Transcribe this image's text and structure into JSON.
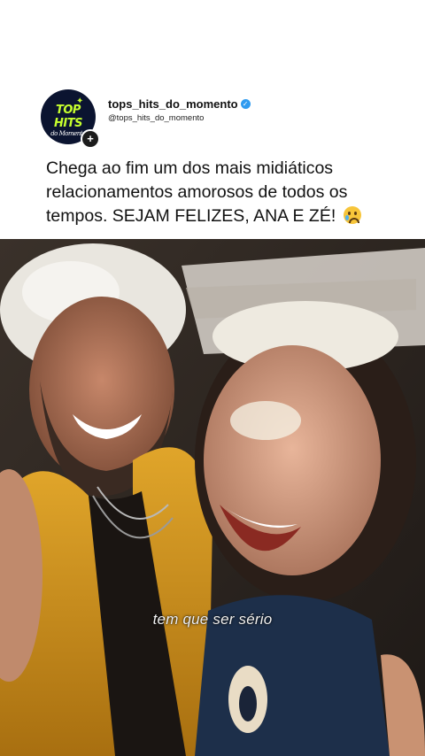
{
  "post": {
    "avatar": {
      "logo_top": "TOP",
      "logo_mid": "HITS",
      "logo_bottom": "do Momento",
      "icon": "top-hits-logo"
    },
    "follow_badge": "+",
    "username": "tops_hits_do_momento",
    "verified_icon": "verified-check-icon",
    "handle": "@tops_hits_do_momento",
    "caption": "Chega ao fim um dos mais midiáticos relacionamentos amorosos de todos os tempos. SEJAM FELIZES, ANA E ZÉ!",
    "caption_emoji": "crying-face-emoji"
  },
  "media": {
    "subtitle": "tem que ser sério"
  },
  "colors": {
    "avatar_bg": "#0b1430",
    "logo_green": "#c6ff2e",
    "verified_blue": "#2f9bf0",
    "text": "#111111"
  }
}
